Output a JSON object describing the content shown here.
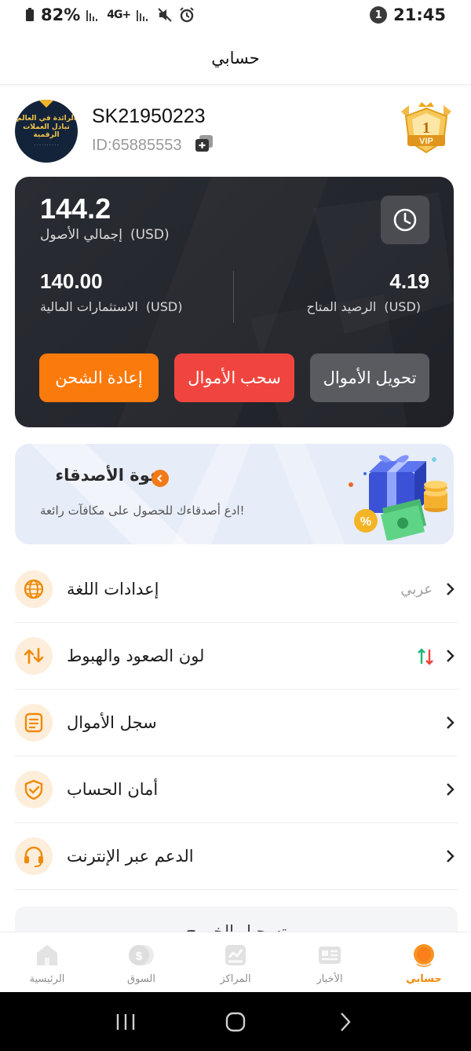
{
  "status_bar": {
    "battery": "82%",
    "network": "4G+",
    "notification_count": "1",
    "time": "21:45"
  },
  "header": {
    "title": "حسابي"
  },
  "profile": {
    "username": "SK21950223",
    "user_id": "ID:65885553",
    "avatar_text": "الرائدة في العالم\nتبادل العملات الرقمية",
    "vip_level": "1",
    "vip_label": "VIP"
  },
  "assets": {
    "total_value": "144.2",
    "total_label": "إجمالي الأصول",
    "total_currency": "(USD)",
    "financial_value": "140.00",
    "financial_label": "الاستثمارات المالية",
    "financial_currency": "(USD)",
    "available_value": "4.19",
    "available_label": "الرصيد المتاح",
    "available_currency": "(USD)",
    "buttons": {
      "recharge": "إعادة الشحن",
      "withdraw": "سحب الأموال",
      "transfer": "تحويل الأموال"
    },
    "colors": {
      "recharge": "#fb7a0c",
      "withdraw": "#f0453e",
      "transfer": "#595b60"
    }
  },
  "invite": {
    "title": "دعوة الأصدقاء",
    "subtitle": "ادع أصدقاءك للحصول على مكافآت رائعة!"
  },
  "menu": [
    {
      "label": "إعدادات اللغة",
      "value": "عربي",
      "icon": "globe-icon"
    },
    {
      "label": "لون الصعود والهبوط",
      "value": "",
      "icon": "up-down-icon"
    },
    {
      "label": "سجل الأموال",
      "value": "",
      "icon": "document-icon"
    },
    {
      "label": "أمان الحساب",
      "value": "",
      "icon": "shield-check-icon"
    },
    {
      "label": "الدعم عبر الإنترنت",
      "value": "",
      "icon": "headset-icon"
    }
  ],
  "peek_text": "تسجيل الخروج",
  "bottom_nav": [
    {
      "label": "الرئيسية",
      "icon": "home-icon",
      "active": false
    },
    {
      "label": "السوق",
      "icon": "market-icon",
      "active": false
    },
    {
      "label": "المراكز",
      "icon": "positions-icon",
      "active": false
    },
    {
      "label": "الأخبار",
      "icon": "news-icon",
      "active": false
    },
    {
      "label": "حسابي",
      "icon": "account-icon",
      "active": true
    }
  ],
  "accent_color": "#f08a0a"
}
